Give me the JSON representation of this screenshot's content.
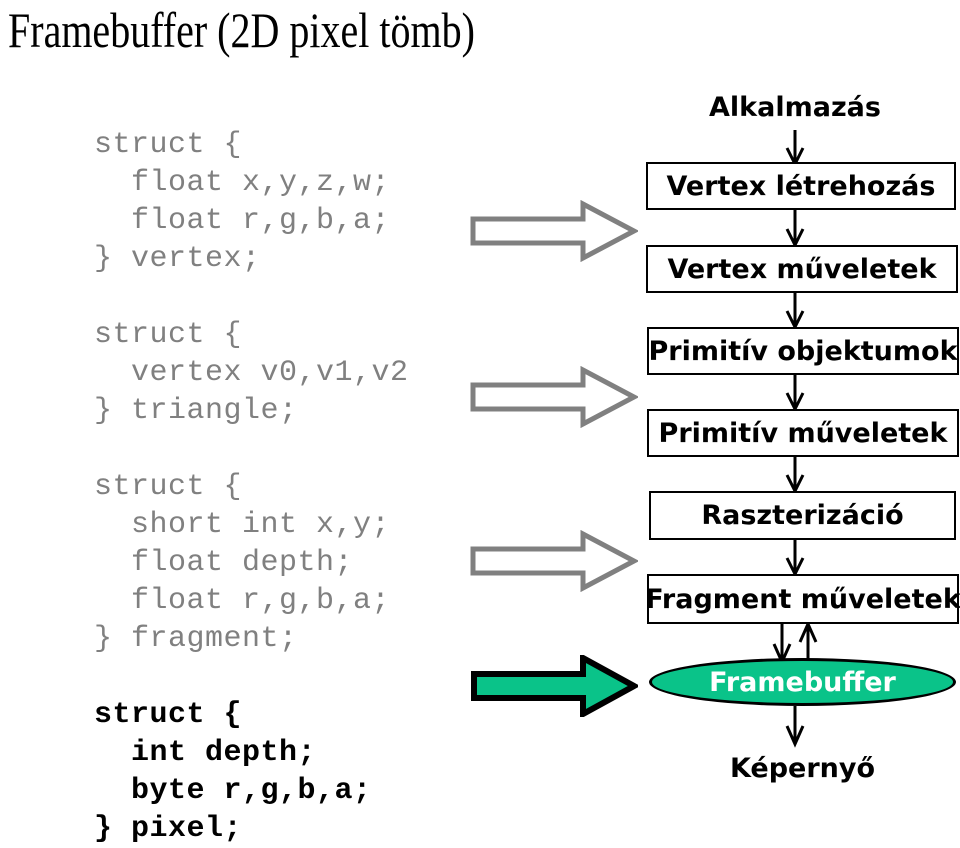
{
  "slide": {
    "title": "Framebuffer (2D pixel tömb)",
    "background_color": "#ffffff",
    "accent_color": "#0ac389",
    "code_gray": "#808080",
    "code_black": "#000000"
  },
  "code_blocks": [
    {
      "id": "vertex-struct",
      "color": "gray",
      "text": "struct {\n  float x,y,z,w;\n  float r,g,b,a;\n} vertex;"
    },
    {
      "id": "triangle-struct",
      "color": "gray",
      "text": "struct {\n  vertex v0,v1,v2\n} triangle;"
    },
    {
      "id": "fragment-struct",
      "color": "gray",
      "text": "struct {\n  short int x,y;\n  float depth;\n  float r,g,b,a;\n} fragment;"
    },
    {
      "id": "pixel-struct",
      "color": "black",
      "text": "struct {\n  int depth;\n  byte r,g,b,a;\n} pixel;"
    }
  ],
  "block_arrows": [
    {
      "id": "arrow-vertex",
      "style": "outline",
      "stroke": "#808080",
      "fill": "#ffffff"
    },
    {
      "id": "arrow-triangle",
      "style": "outline",
      "stroke": "#808080",
      "fill": "#ffffff"
    },
    {
      "id": "arrow-fragment",
      "style": "outline",
      "stroke": "#808080",
      "fill": "#ffffff"
    },
    {
      "id": "arrow-pixel",
      "style": "filled",
      "stroke": "#000000",
      "fill": "#0ac389"
    }
  ],
  "pipeline": {
    "stages": [
      {
        "id": "alkalmazas",
        "label": "Alkalmazás",
        "shape": "plain"
      },
      {
        "id": "vertex-letrehozas",
        "label": "Vertex létrehozás",
        "shape": "box"
      },
      {
        "id": "vertex-muveletek",
        "label": "Vertex műveletek",
        "shape": "box"
      },
      {
        "id": "primitiv-objektumok",
        "label": "Primitív objektumok",
        "shape": "box"
      },
      {
        "id": "primitiv-muveletek",
        "label": "Primitív műveletek",
        "shape": "box"
      },
      {
        "id": "raszterizacio",
        "label": "Raszterizáció",
        "shape": "box"
      },
      {
        "id": "fragment-muveletek",
        "label": "Fragment műveletek",
        "shape": "box"
      },
      {
        "id": "framebuffer",
        "label": "Framebuffer",
        "shape": "ellipse"
      },
      {
        "id": "kepernyo",
        "label": "Képernyő",
        "shape": "plain"
      }
    ],
    "connectors": [
      {
        "from": "alkalmazas",
        "to": "vertex-letrehozas",
        "direction": "down"
      },
      {
        "from": "vertex-letrehozas",
        "to": "vertex-muveletek",
        "direction": "down"
      },
      {
        "from": "vertex-muveletek",
        "to": "primitiv-objektumok",
        "direction": "down"
      },
      {
        "from": "primitiv-objektumok",
        "to": "primitiv-muveletek",
        "direction": "down"
      },
      {
        "from": "primitiv-muveletek",
        "to": "raszterizacio",
        "direction": "down"
      },
      {
        "from": "raszterizacio",
        "to": "fragment-muveletek",
        "direction": "down"
      },
      {
        "from": "fragment-muveletek",
        "to": "framebuffer",
        "direction": "both"
      },
      {
        "from": "framebuffer",
        "to": "kepernyo",
        "direction": "down"
      }
    ]
  }
}
